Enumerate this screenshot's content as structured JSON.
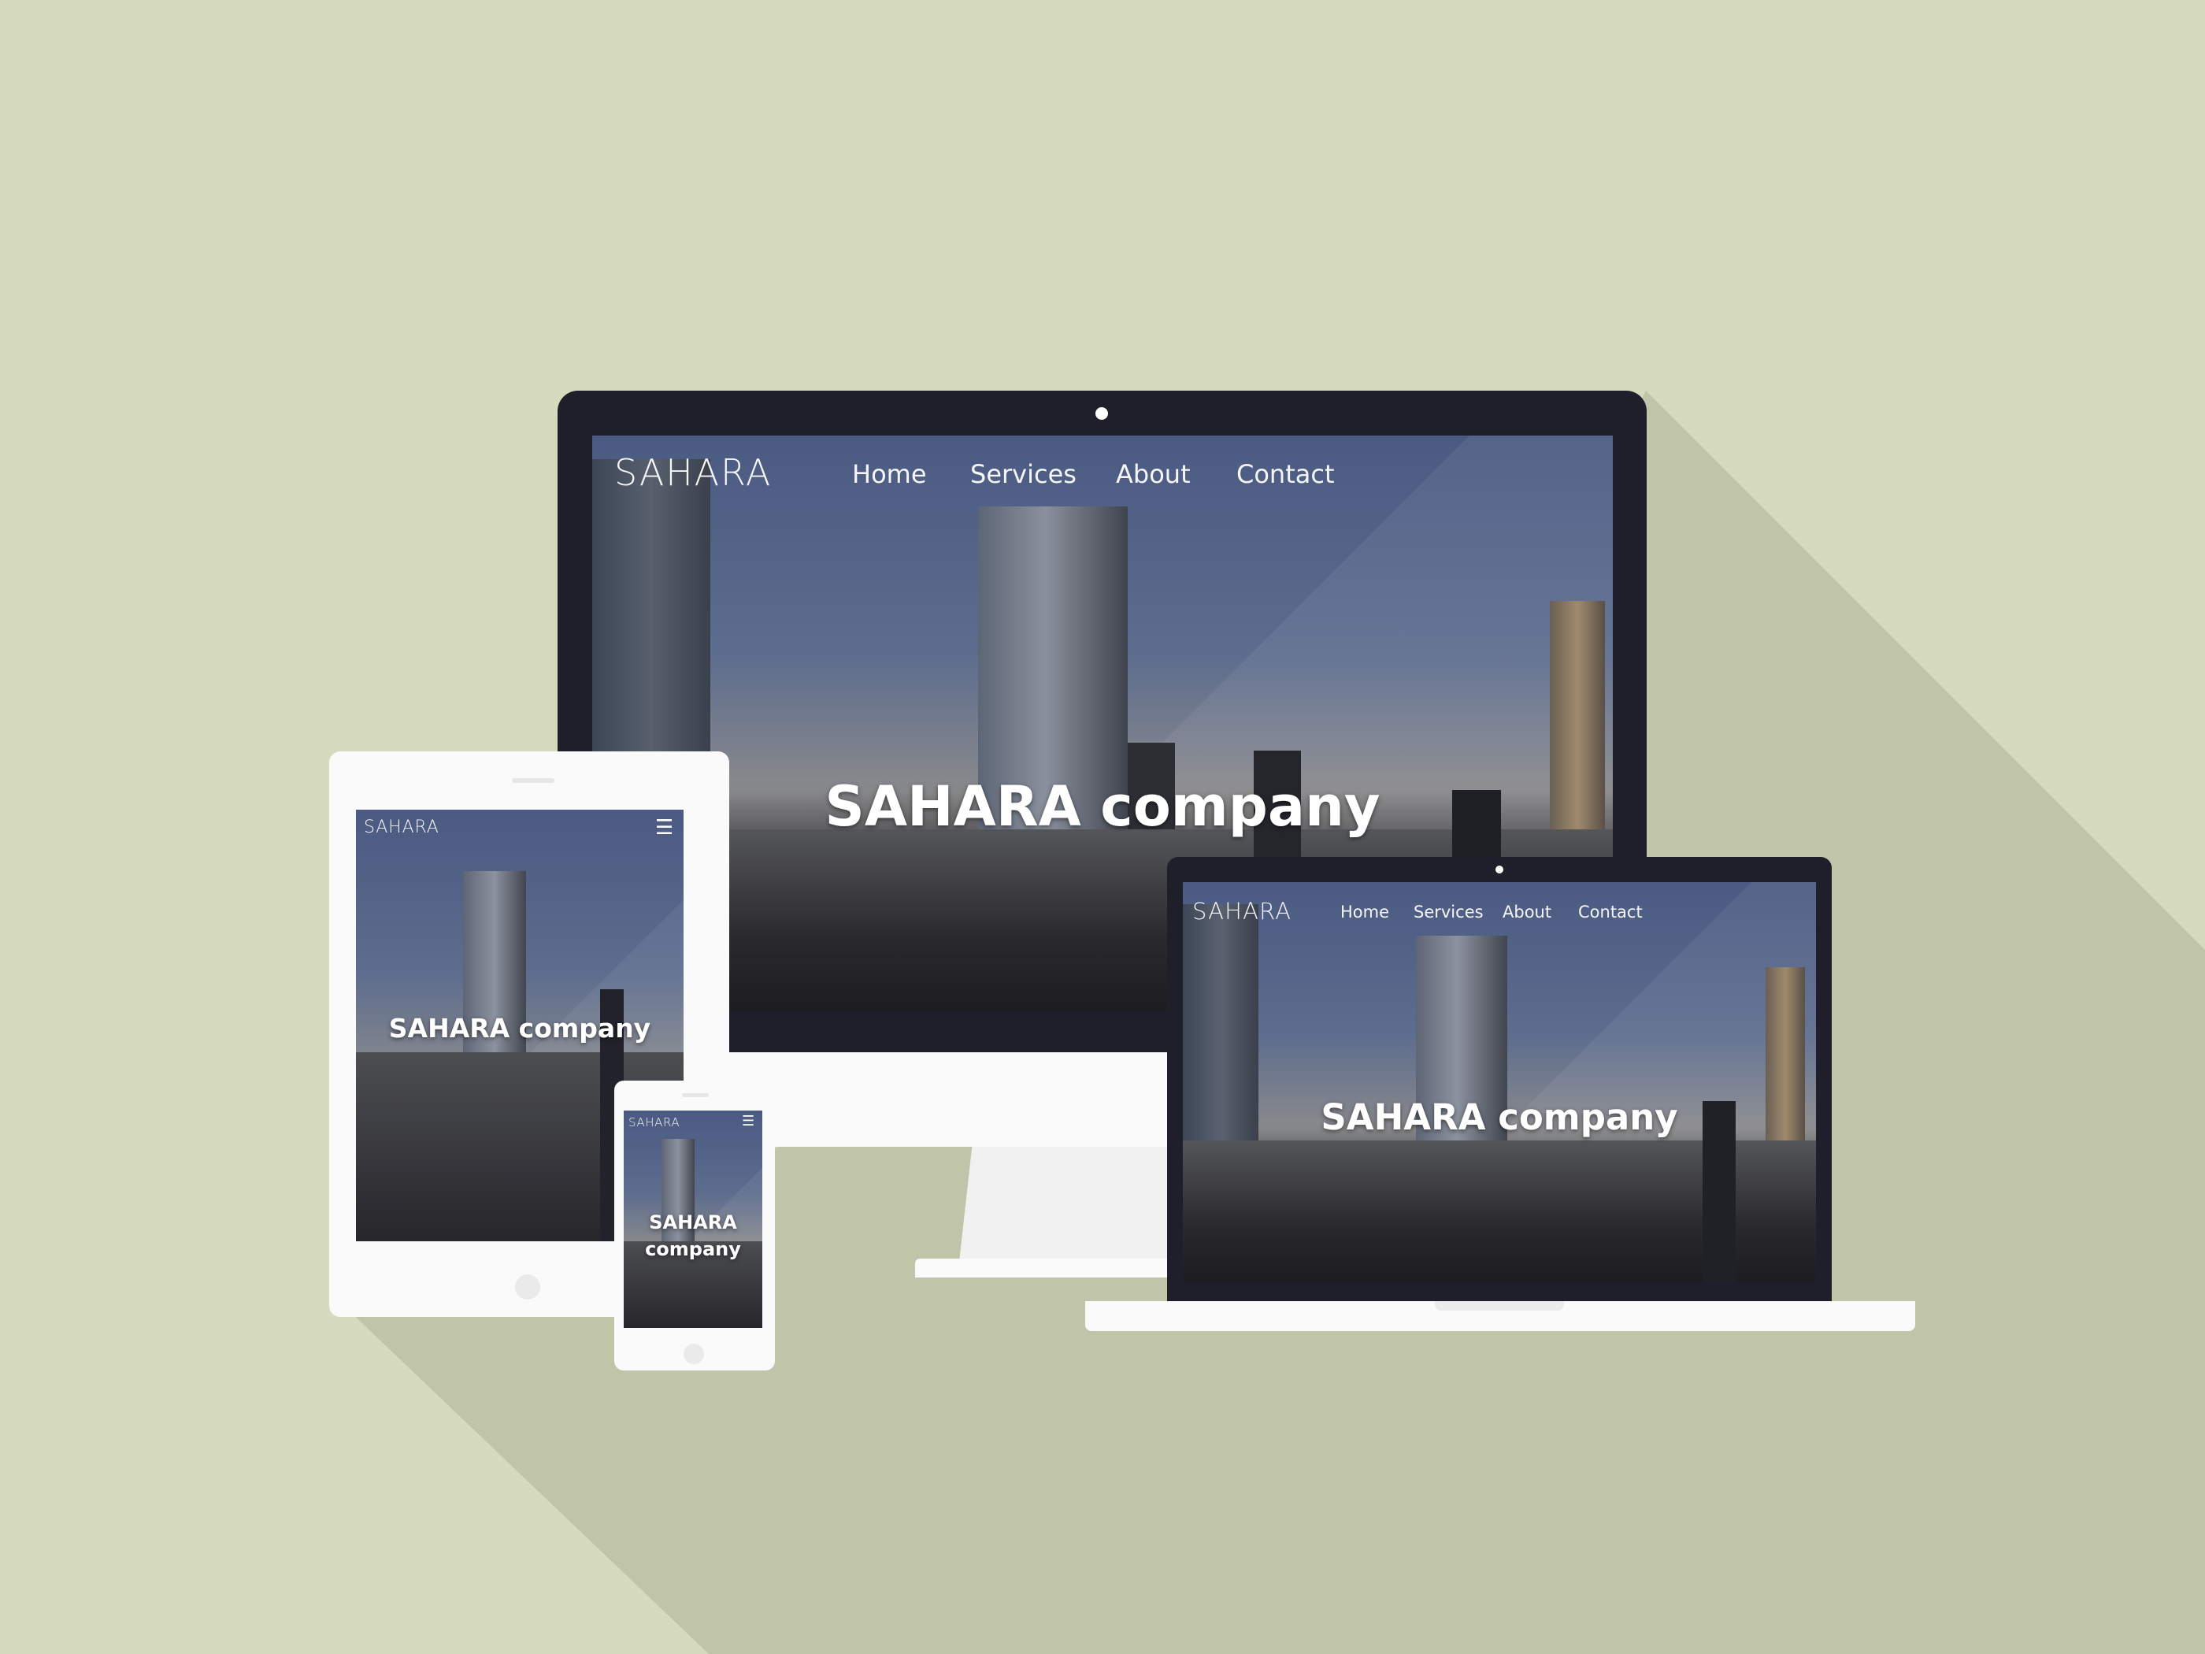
{
  "brand": "SAHARA",
  "hero_title": "SAHARA company",
  "nav": [
    "Home",
    "Services",
    "About",
    "Contact"
  ],
  "mobile_hero_lines": [
    "SAHARA",
    "company"
  ],
  "icons": {
    "menu": "hamburger-menu-icon",
    "camera": "camera-dot-icon",
    "home_button": "home-button-icon"
  },
  "colors": {
    "background": "#d6dabf",
    "long_shadow": "#c0c4a9",
    "device_dark": "#1e1f2b",
    "device_light": "#fafafa"
  }
}
